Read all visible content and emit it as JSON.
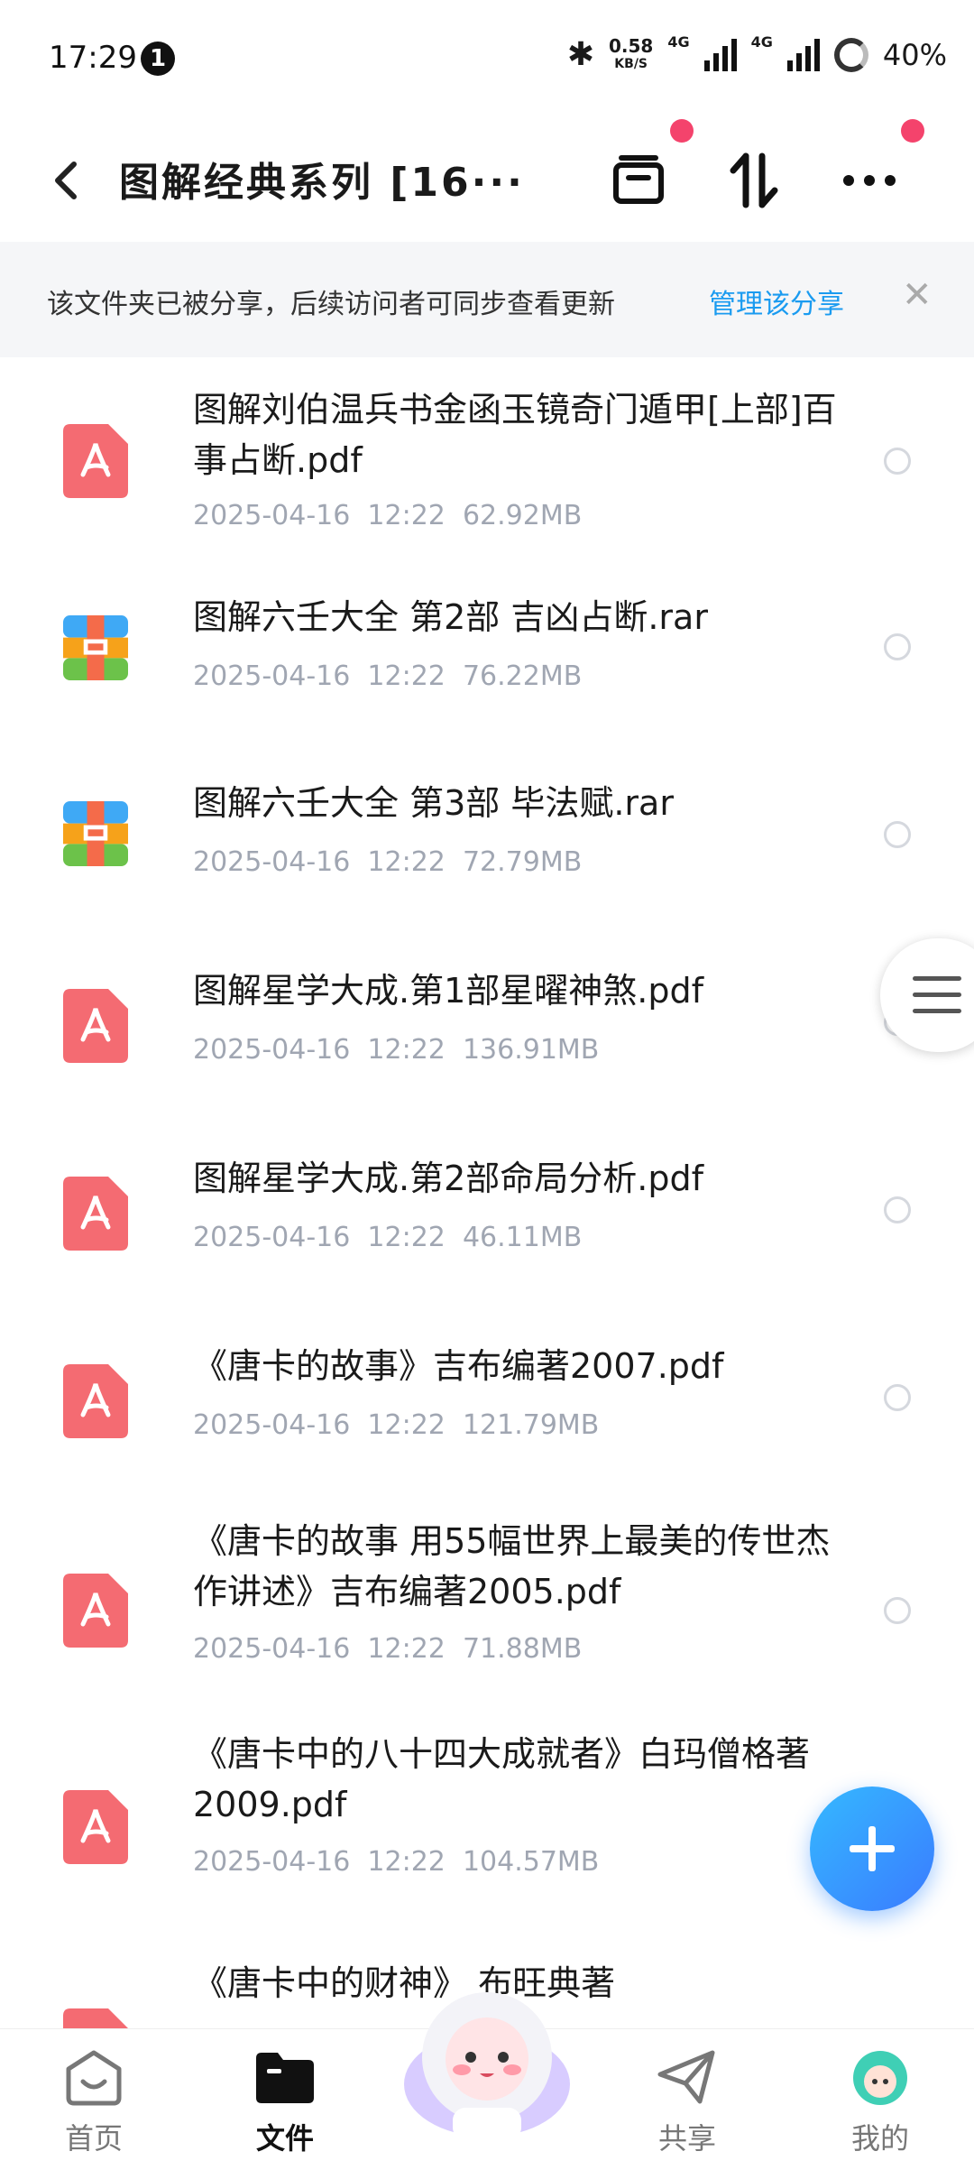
{
  "status_bar": {
    "time": "17:29",
    "notification_count": "1",
    "speed_value": "0.58",
    "speed_unit": "KB/S",
    "net1": "4G",
    "net2": "4G",
    "battery": "40%"
  },
  "header": {
    "title": "图解经典系列 [16···"
  },
  "share_banner": {
    "message": "该文件夹已被分享，后续访问者可同步查看更新",
    "link": "管理该分享",
    "close": "✕"
  },
  "files": [
    {
      "name": "图解刘伯温兵书金函玉镜奇门遁甲[上部]百事占断.pdf",
      "meta": "2025-04-16  12:22  62.92MB",
      "type": "pdf"
    },
    {
      "name": "图解六壬大全 第2部 吉凶占断.rar",
      "meta": "2025-04-16  12:22  76.22MB",
      "type": "rar"
    },
    {
      "name": "图解六壬大全 第3部 毕法赋.rar",
      "meta": "2025-04-16  12:22  72.79MB",
      "type": "rar"
    },
    {
      "name": "图解星学大成.第1部星曜神煞.pdf",
      "meta": "2025-04-16  12:22  136.91MB",
      "type": "pdf"
    },
    {
      "name": "图解星学大成.第2部命局分析.pdf",
      "meta": "2025-04-16  12:22  46.11MB",
      "type": "pdf"
    },
    {
      "name": "《唐卡的故事》吉布编著2007.pdf",
      "meta": "2025-04-16  12:22  121.79MB",
      "type": "pdf"
    },
    {
      "name": "《唐卡的故事 用55幅世界上最美的传世杰作讲述》吉布编著2005.pdf",
      "meta": "2025-04-16  12:22  71.88MB",
      "type": "pdf"
    },
    {
      "name": "《唐卡中的八十四大成就者》白玛僧格著2009.pdf",
      "meta": "2025-04-16  12:22  104.57MB",
      "type": "pdf"
    },
    {
      "name": "《唐卡中的财神》 布旺典著",
      "meta": "",
      "type": "pdf"
    }
  ],
  "nav": {
    "home": "首页",
    "files": "文件",
    "share": "共享",
    "mine": "我的"
  },
  "colors": {
    "accent": "#1a9bf0",
    "pdf_red": "#f46b72",
    "badge": "#f4436c"
  }
}
